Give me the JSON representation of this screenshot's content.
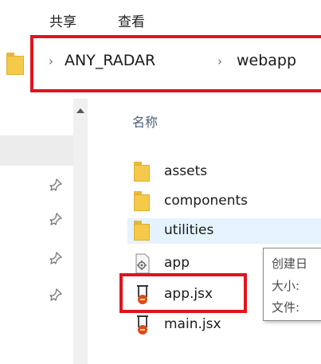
{
  "ribbon": {
    "tabs": [
      "共享",
      "查看"
    ]
  },
  "address_bar": {
    "breadcrumbs": [
      "ANY_RADAR",
      "webapp"
    ],
    "separator": "›",
    "folder_icon": "folder-icon",
    "highlight_color": "#e0141c"
  },
  "navigation_pane": {
    "pin_icon": "pin-icon",
    "pinned_count": 4,
    "scroll_up_icon": "scroll-up-arrow-icon"
  },
  "file_list": {
    "column_header": "名称",
    "items": [
      {
        "name": "assets",
        "type": "folder",
        "icon": "folder-icon"
      },
      {
        "name": "components",
        "type": "folder",
        "icon": "folder-icon"
      },
      {
        "name": "utilities",
        "type": "folder",
        "icon": "folder-icon",
        "selected": true
      },
      {
        "name": "app",
        "type": "file",
        "icon": "gear-file-icon"
      },
      {
        "name": "app.jsx",
        "type": "file",
        "icon": "jsx-file-icon",
        "highlighted": true
      },
      {
        "name": "main.jsx",
        "type": "file",
        "icon": "jsx-file-icon"
      }
    ],
    "selected_row_color": "#e5f3ff"
  },
  "tooltip": {
    "lines": [
      "创建日",
      "大小:",
      "文件:"
    ]
  }
}
